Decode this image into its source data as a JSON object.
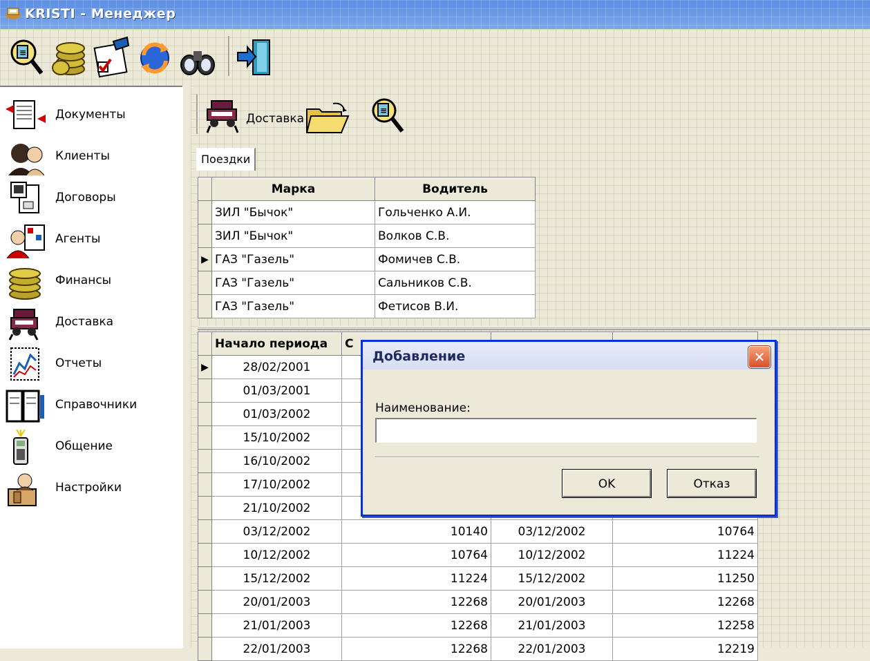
{
  "window": {
    "title": "KRISTI - Менеджер",
    "app_icon": "kristi-app-icon"
  },
  "toolbar": {
    "buttons": [
      {
        "name": "search-document-icon"
      },
      {
        "name": "coins-icon"
      },
      {
        "name": "checklist-icon"
      },
      {
        "name": "refresh-icon"
      },
      {
        "name": "binoculars-icon"
      },
      {
        "name": "exit-door-icon"
      }
    ]
  },
  "sidebar": {
    "items": [
      {
        "label": "Документы",
        "icon": "documents-icon"
      },
      {
        "label": "Клиенты",
        "icon": "clients-icon"
      },
      {
        "label": "Договоры",
        "icon": "contracts-icon"
      },
      {
        "label": "Агенты",
        "icon": "agents-icon"
      },
      {
        "label": "Финансы",
        "icon": "coins-icon"
      },
      {
        "label": "Доставка",
        "icon": "delivery-car-icon"
      },
      {
        "label": "Отчеты",
        "icon": "reports-chart-icon"
      },
      {
        "label": "Справочники",
        "icon": "books-icon"
      },
      {
        "label": "Общение",
        "icon": "phone-icon"
      },
      {
        "label": "Настройки",
        "icon": "settings-desk-icon"
      }
    ]
  },
  "subtoolbar": {
    "label": "Доставка"
  },
  "tabs": [
    {
      "label": "Поездки"
    }
  ],
  "vehicles": {
    "columns": [
      "Марка",
      "Водитель"
    ],
    "rows": [
      [
        "ЗИЛ \"Бычок\"",
        "Гольченко А.И."
      ],
      [
        "ЗИЛ \"Бычок\"",
        "Волков С.В."
      ],
      [
        "ГАЗ \"Газель\"",
        "Фомичев С.В."
      ],
      [
        "ГАЗ \"Газель\"",
        "Сальников С.В."
      ],
      [
        "ГАЗ \"Газель\"",
        "Фетисов В.И."
      ]
    ],
    "current_row": 2
  },
  "periods": {
    "columns": [
      "Начало периода",
      "С",
      "",
      ""
    ],
    "rows": [
      [
        "28/02/2001",
        "",
        "",
        ""
      ],
      [
        "01/03/2001",
        "",
        "",
        ""
      ],
      [
        "01/03/2002",
        "",
        "",
        ""
      ],
      [
        "15/10/2002",
        "",
        "",
        ""
      ],
      [
        "16/10/2002",
        "",
        "",
        ""
      ],
      [
        "17/10/2002",
        "",
        "",
        ""
      ],
      [
        "21/10/2002",
        "",
        "",
        ""
      ],
      [
        "03/12/2002",
        "10140",
        "03/12/2002",
        "10764"
      ],
      [
        "10/12/2002",
        "10764",
        "10/12/2002",
        "11224"
      ],
      [
        "15/12/2002",
        "11224",
        "15/12/2002",
        "11250"
      ],
      [
        "20/01/2003",
        "12268",
        "20/01/2003",
        "12268"
      ],
      [
        "21/01/2003",
        "12268",
        "21/01/2003",
        "12258"
      ],
      [
        "22/01/2003",
        "12268",
        "22/01/2003",
        "12219"
      ]
    ],
    "current_row": 0
  },
  "dialog": {
    "title": "Добавление",
    "field_label": "Наименование:",
    "field_value": "",
    "ok_label": "OK",
    "cancel_label": "Отказ"
  }
}
